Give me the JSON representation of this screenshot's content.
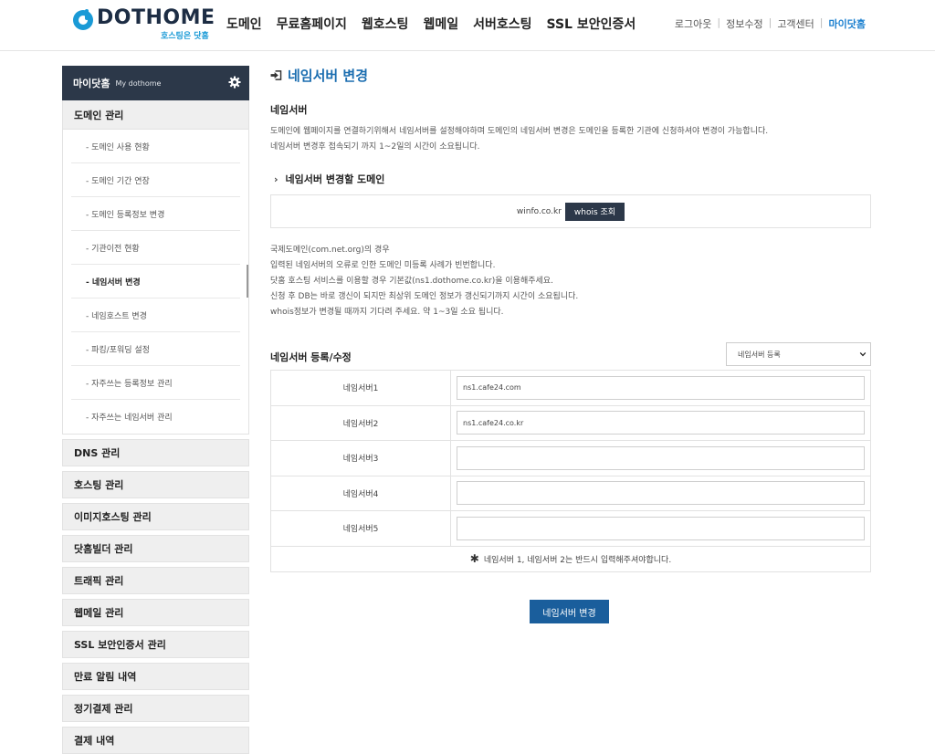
{
  "header": {
    "logo_text": "DOTHOME",
    "logo_sub": "호스팅은 닷홈",
    "nav": [
      "도메인",
      "무료홈페이지",
      "웹호스팅",
      "웹메일",
      "서버호스팅",
      "SSL 보안인증서"
    ],
    "util": [
      "로그아웃",
      "정보수정",
      "고객센터",
      "마이닷홈"
    ]
  },
  "sidebar": {
    "head_title": "마이닷홈",
    "head_sub": "My dothome",
    "section": "도메인 관리",
    "sub_items": [
      "- 도메인 사용 현황",
      "- 도메인 기간 연장",
      "- 도메인 등록정보 변경",
      "- 기관이전 현황",
      "- 네임서버 변경",
      "- 네임호스트 변경",
      "- 파킹/포워딩 설정",
      "- 자주쓰는 등록정보 관리",
      "- 자주쓰는 네임서버 관리"
    ],
    "categories": [
      "DNS 관리",
      "호스팅 관리",
      "이미지호스팅 관리",
      "닷홈빌더 관리",
      "트래픽 관리",
      "웹메일 관리",
      "SSL 보안인증서 관리",
      "만료 알림 내역",
      "정기결제 관리",
      "결제 내역"
    ]
  },
  "main": {
    "title": "네임서버 변경",
    "section_title": "네임서버",
    "desc_lines": [
      "도메인에 웹페이지를 연결하기위해서 네임서버를 설정해야하며 도메인의 네임서버 변경은 도메인을 등록한 기관에 신청하셔야 변경이 가능합니다.",
      "네임서버 변경후 접속되기 까지 1~2일의 시간이 소요됩니다."
    ],
    "domain_title": "네임서버 변경할 도메인",
    "domain": "winfo.co.kr",
    "whois_label": "whois 조회",
    "notice_lines": [
      "국제도메인(com.net.org)의 경우",
      "입력된 네임서버의 오류로 인한 도메인 미등록 사례가 빈번합니다.",
      "닷홈 호스팅 서비스를 이용할 경우 기본값(ns1.dothome.co.kr)을 이용해주세요.",
      "신청 후 DB는 바로 갱신이 되지만 최상위 도메인 정보가 갱신되기까지 시간이 소요됩니다.",
      "whois정보가 변경될 때까지 기다려 주세요. 약 1~3일 소요 됩니다."
    ],
    "reg_title": "네임서버 등록/수정",
    "reg_select": "네임서버 등록",
    "nameservers": [
      {
        "label": "네임서버1",
        "value": "ns1.cafe24.com"
      },
      {
        "label": "네임서버2",
        "value": "ns1.cafe24.co.kr"
      },
      {
        "label": "네임서버3",
        "value": ""
      },
      {
        "label": "네임서버4",
        "value": ""
      },
      {
        "label": "네임서버5",
        "value": ""
      }
    ],
    "ns_note": "네임서버 1, 네임서버 2는 반드시 입력해주셔야합니다.",
    "submit_label": "네임서버 변경"
  }
}
